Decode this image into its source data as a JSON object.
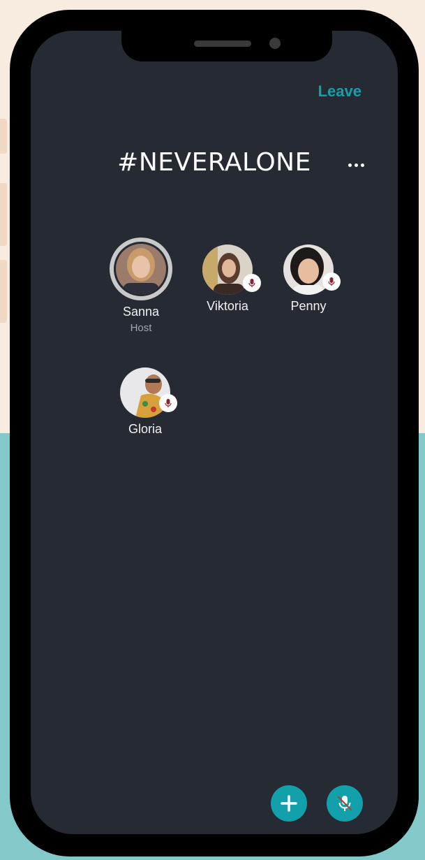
{
  "header": {
    "leave_label": "Leave",
    "room_title": "#NEVERALONE",
    "more_icon": "more-horizontal-icon"
  },
  "participants": [
    {
      "name": "Sanna",
      "role": "Host",
      "muted": false
    },
    {
      "name": "Viktoria",
      "role": "",
      "muted": true
    },
    {
      "name": "Penny",
      "role": "",
      "muted": true
    },
    {
      "name": "Gloria",
      "role": "",
      "muted": true
    }
  ],
  "controls": {
    "add_icon": "plus-icon",
    "mic_icon": "mic-off-icon"
  },
  "colors": {
    "accent": "#12a1ab",
    "screen_bg": "#262a33",
    "page_bg": "#f8ebe0",
    "page_bg_bottom": "#83c9c9"
  }
}
